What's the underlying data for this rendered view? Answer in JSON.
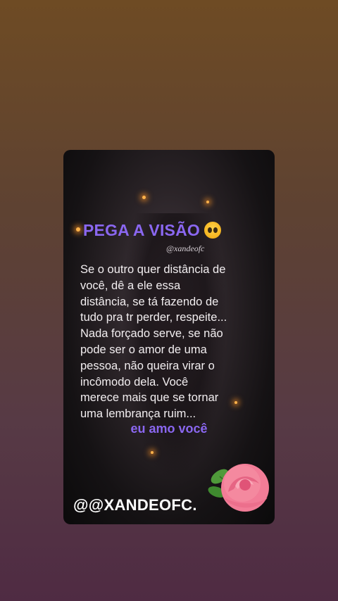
{
  "post": {
    "title": "PEGA A VISÃO",
    "title_emoji": "pleading-face-icon",
    "watermark": "@xandeofc",
    "lines": [
      "Se o outro quer distância de",
      "você, dê a ele essa",
      "distância, se tá fazendo de",
      "tudo pra tr perder, respeite...",
      "Nada forçado serve, se não",
      "pode ser o amor de uma",
      "pessoa, não queira virar o",
      "incômodo dela. Você",
      "merece mais que se tornar",
      "uma lembrança ruim..."
    ],
    "signature": "eu amo você",
    "handle": "@@XANDEOFC.",
    "decoration": "rose-icon"
  },
  "colors": {
    "accent_purple": "#8a67f0",
    "text_white": "#f2eef0",
    "bg_top": "#6e4b24",
    "bg_bottom": "#4f2b43"
  }
}
